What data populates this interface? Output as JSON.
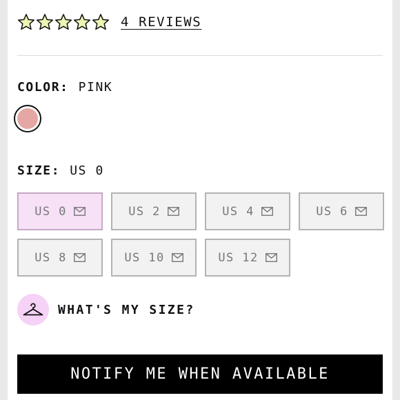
{
  "rating": {
    "stars_total": 5,
    "stars_filled": 5,
    "star_color": "#eef5b3",
    "reviews_label": "4 REVIEWS"
  },
  "color": {
    "label": "COLOR:",
    "value": "PINK",
    "swatches": [
      {
        "name": "pink",
        "hex": "#e5a7a3",
        "selected": true
      }
    ]
  },
  "size": {
    "label": "SIZE:",
    "value": "US 0",
    "options": [
      {
        "label": "US 0",
        "selected": true,
        "icon": "mail-icon"
      },
      {
        "label": "US 2",
        "selected": false,
        "icon": "mail-icon"
      },
      {
        "label": "US 4",
        "selected": false,
        "icon": "mail-icon"
      },
      {
        "label": "US 6",
        "selected": false,
        "icon": "mail-icon"
      },
      {
        "label": "US 8",
        "selected": false,
        "icon": "mail-icon"
      },
      {
        "label": "US 10",
        "selected": false,
        "icon": "mail-icon"
      },
      {
        "label": "US 12",
        "selected": false,
        "icon": "mail-icon"
      }
    ]
  },
  "size_guide": {
    "label": "WHAT'S MY SIZE?",
    "icon": "hanger-icon"
  },
  "cta": {
    "label": "NOTIFY ME WHEN AVAILABLE"
  },
  "colors": {
    "selected_size_bg": "#f7e1f7",
    "hanger_circle_bg": "#f6d3f6",
    "cta_bg": "#000000"
  }
}
